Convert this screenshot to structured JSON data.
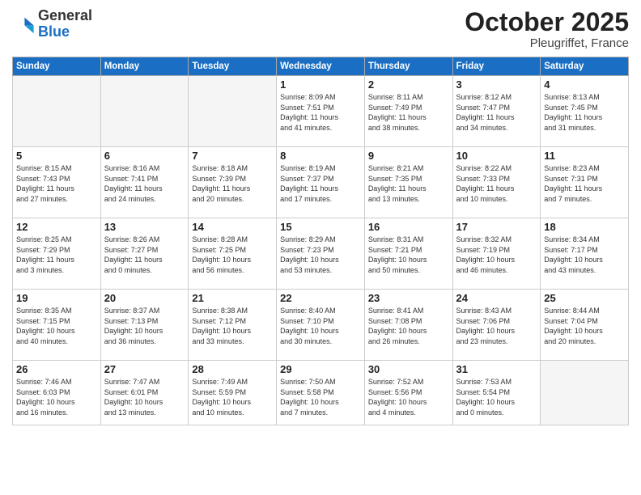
{
  "header": {
    "logo_general": "General",
    "logo_blue": "Blue",
    "month": "October 2025",
    "location": "Pleugriffet, France"
  },
  "days_of_week": [
    "Sunday",
    "Monday",
    "Tuesday",
    "Wednesday",
    "Thursday",
    "Friday",
    "Saturday"
  ],
  "weeks": [
    [
      {
        "day": "",
        "info": ""
      },
      {
        "day": "",
        "info": ""
      },
      {
        "day": "",
        "info": ""
      },
      {
        "day": "1",
        "info": "Sunrise: 8:09 AM\nSunset: 7:51 PM\nDaylight: 11 hours\nand 41 minutes."
      },
      {
        "day": "2",
        "info": "Sunrise: 8:11 AM\nSunset: 7:49 PM\nDaylight: 11 hours\nand 38 minutes."
      },
      {
        "day": "3",
        "info": "Sunrise: 8:12 AM\nSunset: 7:47 PM\nDaylight: 11 hours\nand 34 minutes."
      },
      {
        "day": "4",
        "info": "Sunrise: 8:13 AM\nSunset: 7:45 PM\nDaylight: 11 hours\nand 31 minutes."
      }
    ],
    [
      {
        "day": "5",
        "info": "Sunrise: 8:15 AM\nSunset: 7:43 PM\nDaylight: 11 hours\nand 27 minutes."
      },
      {
        "day": "6",
        "info": "Sunrise: 8:16 AM\nSunset: 7:41 PM\nDaylight: 11 hours\nand 24 minutes."
      },
      {
        "day": "7",
        "info": "Sunrise: 8:18 AM\nSunset: 7:39 PM\nDaylight: 11 hours\nand 20 minutes."
      },
      {
        "day": "8",
        "info": "Sunrise: 8:19 AM\nSunset: 7:37 PM\nDaylight: 11 hours\nand 17 minutes."
      },
      {
        "day": "9",
        "info": "Sunrise: 8:21 AM\nSunset: 7:35 PM\nDaylight: 11 hours\nand 13 minutes."
      },
      {
        "day": "10",
        "info": "Sunrise: 8:22 AM\nSunset: 7:33 PM\nDaylight: 11 hours\nand 10 minutes."
      },
      {
        "day": "11",
        "info": "Sunrise: 8:23 AM\nSunset: 7:31 PM\nDaylight: 11 hours\nand 7 minutes."
      }
    ],
    [
      {
        "day": "12",
        "info": "Sunrise: 8:25 AM\nSunset: 7:29 PM\nDaylight: 11 hours\nand 3 minutes."
      },
      {
        "day": "13",
        "info": "Sunrise: 8:26 AM\nSunset: 7:27 PM\nDaylight: 11 hours\nand 0 minutes."
      },
      {
        "day": "14",
        "info": "Sunrise: 8:28 AM\nSunset: 7:25 PM\nDaylight: 10 hours\nand 56 minutes."
      },
      {
        "day": "15",
        "info": "Sunrise: 8:29 AM\nSunset: 7:23 PM\nDaylight: 10 hours\nand 53 minutes."
      },
      {
        "day": "16",
        "info": "Sunrise: 8:31 AM\nSunset: 7:21 PM\nDaylight: 10 hours\nand 50 minutes."
      },
      {
        "day": "17",
        "info": "Sunrise: 8:32 AM\nSunset: 7:19 PM\nDaylight: 10 hours\nand 46 minutes."
      },
      {
        "day": "18",
        "info": "Sunrise: 8:34 AM\nSunset: 7:17 PM\nDaylight: 10 hours\nand 43 minutes."
      }
    ],
    [
      {
        "day": "19",
        "info": "Sunrise: 8:35 AM\nSunset: 7:15 PM\nDaylight: 10 hours\nand 40 minutes."
      },
      {
        "day": "20",
        "info": "Sunrise: 8:37 AM\nSunset: 7:13 PM\nDaylight: 10 hours\nand 36 minutes."
      },
      {
        "day": "21",
        "info": "Sunrise: 8:38 AM\nSunset: 7:12 PM\nDaylight: 10 hours\nand 33 minutes."
      },
      {
        "day": "22",
        "info": "Sunrise: 8:40 AM\nSunset: 7:10 PM\nDaylight: 10 hours\nand 30 minutes."
      },
      {
        "day": "23",
        "info": "Sunrise: 8:41 AM\nSunset: 7:08 PM\nDaylight: 10 hours\nand 26 minutes."
      },
      {
        "day": "24",
        "info": "Sunrise: 8:43 AM\nSunset: 7:06 PM\nDaylight: 10 hours\nand 23 minutes."
      },
      {
        "day": "25",
        "info": "Sunrise: 8:44 AM\nSunset: 7:04 PM\nDaylight: 10 hours\nand 20 minutes."
      }
    ],
    [
      {
        "day": "26",
        "info": "Sunrise: 7:46 AM\nSunset: 6:03 PM\nDaylight: 10 hours\nand 16 minutes."
      },
      {
        "day": "27",
        "info": "Sunrise: 7:47 AM\nSunset: 6:01 PM\nDaylight: 10 hours\nand 13 minutes."
      },
      {
        "day": "28",
        "info": "Sunrise: 7:49 AM\nSunset: 5:59 PM\nDaylight: 10 hours\nand 10 minutes."
      },
      {
        "day": "29",
        "info": "Sunrise: 7:50 AM\nSunset: 5:58 PM\nDaylight: 10 hours\nand 7 minutes."
      },
      {
        "day": "30",
        "info": "Sunrise: 7:52 AM\nSunset: 5:56 PM\nDaylight: 10 hours\nand 4 minutes."
      },
      {
        "day": "31",
        "info": "Sunrise: 7:53 AM\nSunset: 5:54 PM\nDaylight: 10 hours\nand 0 minutes."
      },
      {
        "day": "",
        "info": ""
      }
    ]
  ]
}
